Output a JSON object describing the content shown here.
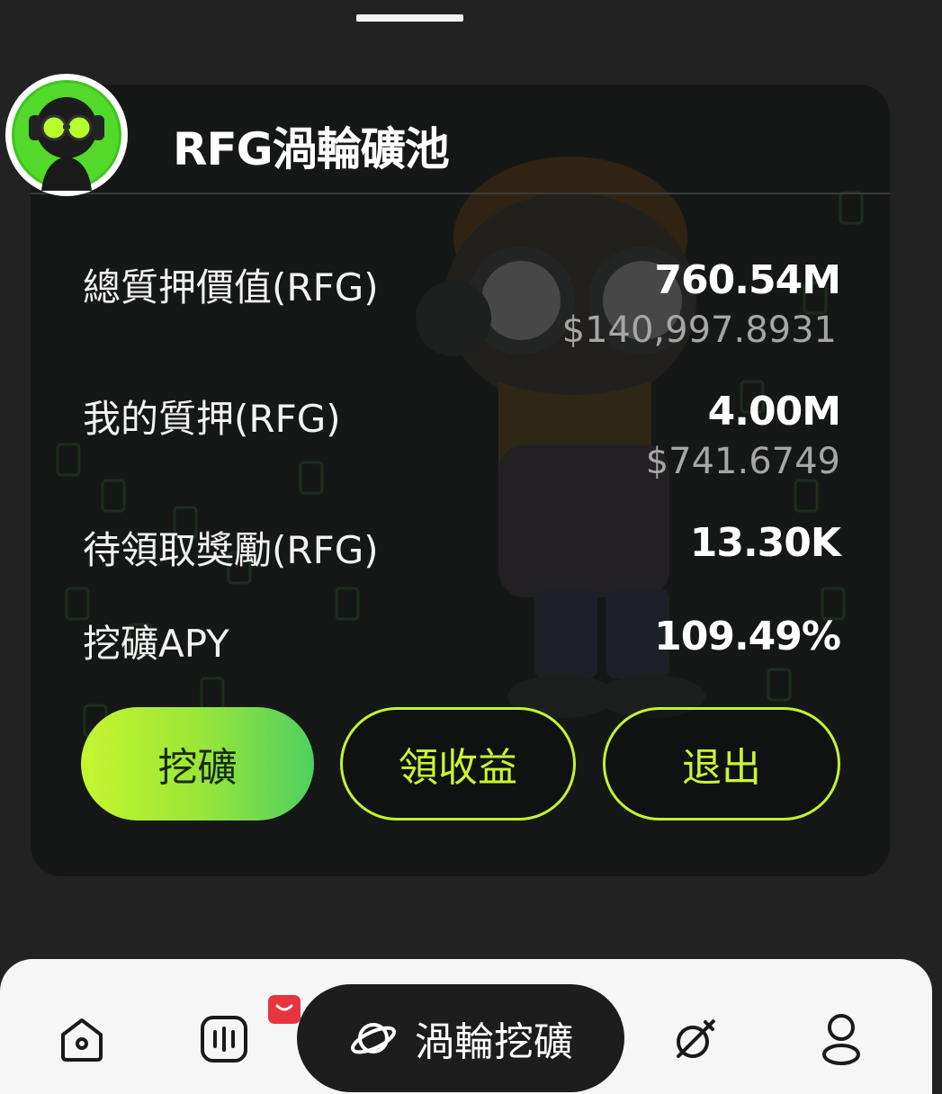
{
  "pool": {
    "title": "RFG渦輪礦池"
  },
  "stats": [
    {
      "label": "總質押價值(RFG)",
      "value": "760.54M",
      "sub": "$140,997.8931"
    },
    {
      "label": "我的質押(RFG)",
      "value": "4.00M",
      "sub": "$741.6749"
    },
    {
      "label": "待領取獎勵(RFG)",
      "value": "13.30K"
    },
    {
      "label": "挖礦APY",
      "value": "109.49%"
    }
  ],
  "actions": {
    "mine": "挖礦",
    "claim": "領收益",
    "exit": "退出"
  },
  "tabbar": {
    "items": [
      {
        "icon": "home-icon"
      },
      {
        "icon": "market-icon",
        "badge": "chat-badge-icon"
      },
      {
        "icon": "planet-icon",
        "label": "渦輪挖礦",
        "active": true
      },
      {
        "icon": "rocket-icon"
      },
      {
        "icon": "profile-icon"
      }
    ]
  },
  "colors": {
    "accent": "#c1f532",
    "background": "#222222",
    "card": "#191919",
    "badge": "#e8343f"
  }
}
